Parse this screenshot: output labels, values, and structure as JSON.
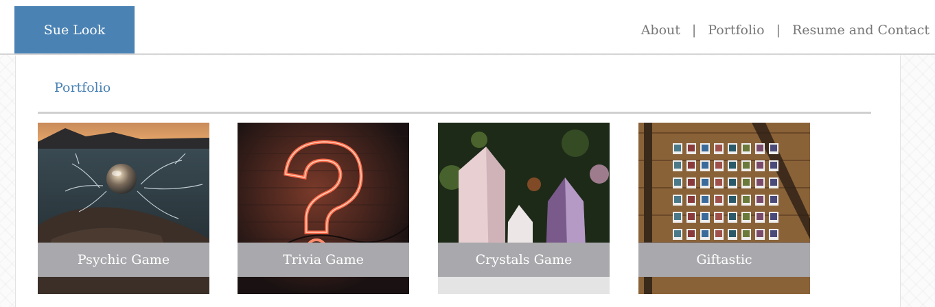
{
  "brand": {
    "label": "Sue Look"
  },
  "nav": {
    "items": [
      {
        "label": "About"
      },
      {
        "label": "Portfolio"
      },
      {
        "label": "Resume and Contact"
      }
    ],
    "separator": "|"
  },
  "section": {
    "title": "Portfolio"
  },
  "portfolio": {
    "items": [
      {
        "label": "Psychic Game",
        "image": "crystal-ball-on-rock-image"
      },
      {
        "label": "Trivia Game",
        "image": "neon-question-mark-image"
      },
      {
        "label": "Crystals Game",
        "image": "quartz-crystals-image"
      },
      {
        "label": "Giftastic",
        "image": "polaroid-wall-image"
      }
    ]
  },
  "colors": {
    "brand": "#4a82b4",
    "caption_bg": "#a9a9ad",
    "nav_text": "#777777"
  }
}
